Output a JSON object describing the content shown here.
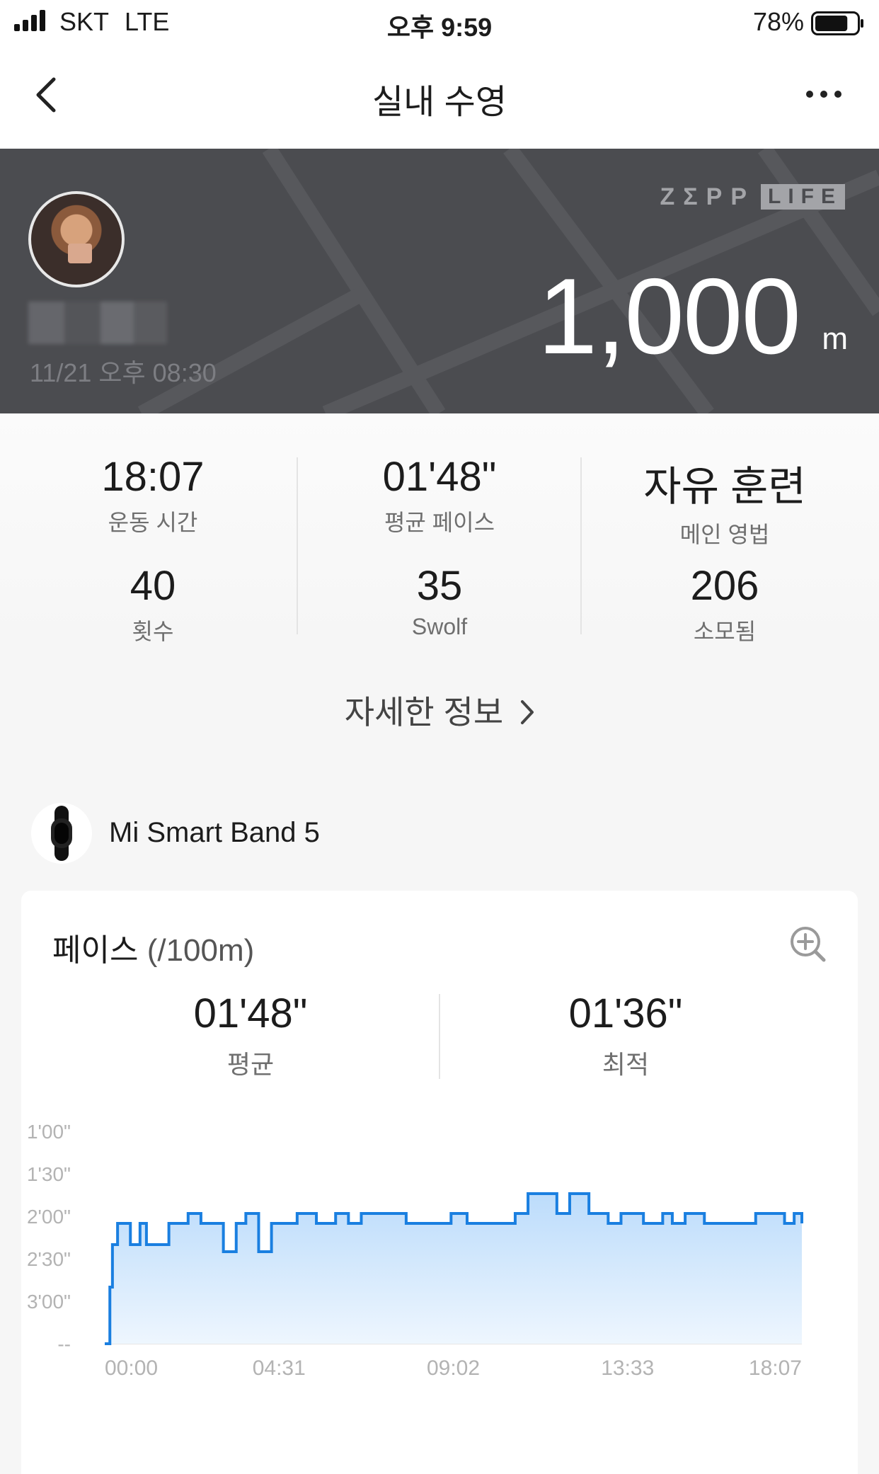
{
  "status_bar": {
    "carrier": "SKT",
    "network": "LTE",
    "time": "오후 9:59",
    "battery": "78%",
    "battery_level": 0.78
  },
  "nav": {
    "title": "실내 수영",
    "back_icon": "chevron-left-icon",
    "more_icon": "more-horizontal-icon"
  },
  "header": {
    "date": "11/21 오후 08:30",
    "brand_zepp": "ZΣPP",
    "brand_life": "LIFE",
    "distance": "1,000",
    "distance_unit": "m"
  },
  "stats": [
    {
      "value": "18:07",
      "label": "운동 시간"
    },
    {
      "value": "01'48\"",
      "label": "평균 페이스"
    },
    {
      "value": "자유 훈련",
      "label": "메인 영법"
    },
    {
      "value": "40",
      "label": "횟수"
    },
    {
      "value": "35",
      "label": "Swolf"
    },
    {
      "value": "206",
      "label": "소모됨"
    }
  ],
  "detail_link": "자세한 정보",
  "device": {
    "name": "Mi Smart Band 5",
    "icon": "smart-band-icon"
  },
  "pace_card": {
    "title": "페이스",
    "title_unit": "(/100m)",
    "average_value": "01'48\"",
    "average_label": "평균",
    "best_value": "01'36\"",
    "best_label": "최적",
    "accent_color": "#1a7fe0"
  },
  "chart_data": {
    "type": "area",
    "title": "페이스 (/100m)",
    "xlabel": "",
    "ylabel": "",
    "x_ticks": [
      "00:00",
      "04:31",
      "09:02",
      "13:33",
      "18:07"
    ],
    "y_ticks": [
      "1'00\"",
      "1'30\"",
      "2'00\"",
      "2'30\"",
      "3'00\"",
      "--"
    ],
    "y_inverted": true,
    "y_unit": "seconds per 100m",
    "ylim": [
      60,
      210
    ],
    "xlim_seconds": [
      0,
      1087
    ],
    "x_seconds": [
      0,
      5,
      8,
      12,
      20,
      40,
      55,
      65,
      100,
      130,
      150,
      185,
      205,
      220,
      240,
      260,
      300,
      330,
      360,
      380,
      400,
      430,
      470,
      480,
      520,
      540,
      565,
      585,
      630,
      640,
      660,
      690,
      705,
      725,
      755,
      785,
      805,
      840,
      870,
      885,
      905,
      935,
      960,
      1000,
      1015,
      1045,
      1060,
      1075,
      1087
    ],
    "pace_seconds": [
      210,
      210,
      170,
      140,
      125,
      140,
      125,
      140,
      125,
      118,
      125,
      145,
      125,
      118,
      145,
      125,
      118,
      125,
      118,
      125,
      118,
      118,
      125,
      125,
      125,
      118,
      125,
      125,
      125,
      118,
      104,
      104,
      118,
      104,
      118,
      125,
      118,
      125,
      118,
      125,
      118,
      125,
      125,
      125,
      118,
      118,
      125,
      118,
      125
    ],
    "grid": false,
    "legend": "none"
  }
}
